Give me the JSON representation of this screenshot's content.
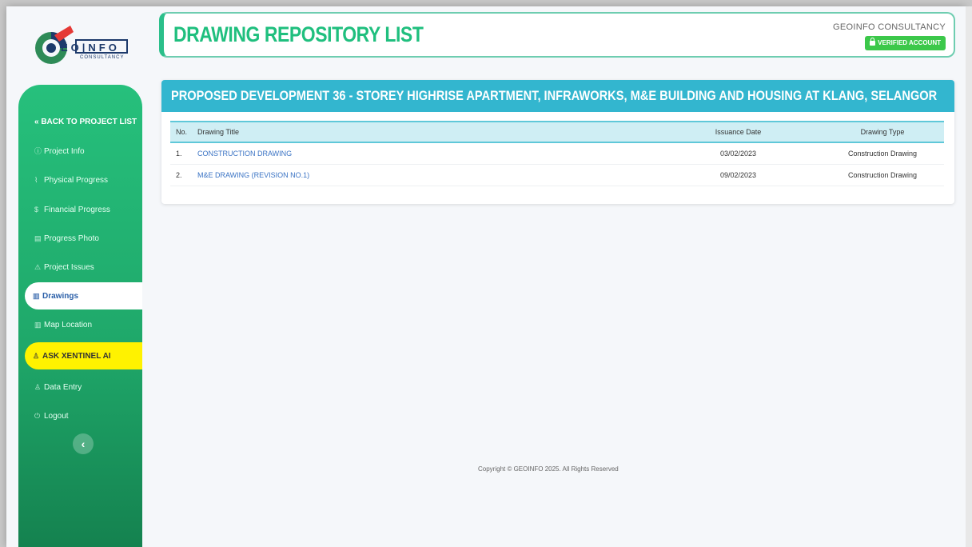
{
  "brand": {
    "logo_text": "EO|NFO",
    "logo_sub": "CONSULTANCY",
    "company": "GEOINFO CONSULTANCY",
    "verified_label": "VERIFIED ACCOUNT"
  },
  "header": {
    "title": "DRAWING REPOSITORY LIST"
  },
  "sidebar": {
    "items": [
      {
        "label": "« BACK TO PROJECT LIST",
        "icon": "back-icon"
      },
      {
        "label": "Project Info",
        "icon": "info-icon"
      },
      {
        "label": "Physical Progress",
        "icon": "chart-icon"
      },
      {
        "label": "Financial Progress",
        "icon": "dollar-icon"
      },
      {
        "label": "Progress Photo",
        "icon": "photo-icon"
      },
      {
        "label": "Project Issues",
        "icon": "warning-icon"
      },
      {
        "label": "Drawings",
        "icon": "map-icon"
      },
      {
        "label": "Map Location",
        "icon": "city-icon"
      },
      {
        "label": "ASK XENTINEL AI",
        "icon": "ai-user-icon"
      },
      {
        "label": "Data Entry",
        "icon": "user-icon"
      },
      {
        "label": "Logout",
        "icon": "power-icon"
      }
    ],
    "collapse_glyph": "‹"
  },
  "project": {
    "title": "PROPOSED DEVELOPMENT 36 - STOREY HIGHRISE APARTMENT, INFRAWORKS, M&E BUILDING AND HOUSING AT KLANG, SELANGOR",
    "columns": [
      "No.",
      "Drawing Title",
      "Issuance Date",
      "Drawing Type"
    ],
    "rows": [
      {
        "no": "1.",
        "title": "CONSTRUCTION DRAWING",
        "date": "03/02/2023",
        "type": "Construction Drawing"
      },
      {
        "no": "2.",
        "title": "M&E DRAWING (REVISION NO.1)",
        "date": "09/02/2023",
        "type": "Construction Drawing"
      }
    ]
  },
  "footer": {
    "copyright": "Copyright © GEOINFO 2025. All Rights Reserved"
  },
  "colors": {
    "accent_green": "#26c07c",
    "header_title": "#1fbf7e",
    "card_header": "#33b6cf",
    "ai_highlight": "#fff200",
    "verified": "#3cc84a"
  }
}
